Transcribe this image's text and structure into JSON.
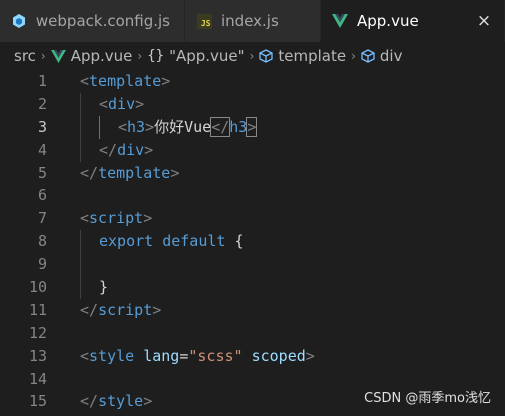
{
  "tabs": [
    {
      "label": "webpack.config.js",
      "icon": "webpack-icon",
      "active": false
    },
    {
      "label": "index.js",
      "icon": "js-file-icon",
      "badge": "JS",
      "active": false
    },
    {
      "label": "App.vue",
      "icon": "vue-icon",
      "active": true,
      "close": "×"
    }
  ],
  "breadcrumb": {
    "items": [
      "src",
      "App.vue",
      "\"App.vue\"",
      "template",
      "div"
    ],
    "braces": "{}",
    "separator": "›"
  },
  "editor": {
    "current_line": 3,
    "lines": [
      {
        "n": "1",
        "tokens": [
          [
            "p",
            "<"
          ],
          [
            "tg",
            "template"
          ],
          [
            "p",
            ">"
          ]
        ]
      },
      {
        "n": "2",
        "tokens": [
          [
            "p",
            "<"
          ],
          [
            "tg",
            "div"
          ],
          [
            "p",
            ">"
          ]
        ]
      },
      {
        "n": "3",
        "tokens": [
          [
            "p",
            "<"
          ],
          [
            "tg",
            "h3"
          ],
          [
            "p",
            ">"
          ],
          [
            "tx",
            "你好Vue"
          ],
          [
            "p",
            "</"
          ],
          [
            "tg",
            "h3"
          ],
          [
            "p",
            ">"
          ]
        ]
      },
      {
        "n": "4",
        "tokens": [
          [
            "p",
            "</"
          ],
          [
            "tg",
            "div"
          ],
          [
            "p",
            ">"
          ]
        ]
      },
      {
        "n": "5",
        "tokens": [
          [
            "p",
            "</"
          ],
          [
            "tg",
            "template"
          ],
          [
            "p",
            ">"
          ]
        ]
      },
      {
        "n": "6",
        "tokens": []
      },
      {
        "n": "7",
        "tokens": [
          [
            "p",
            "<"
          ],
          [
            "tg",
            "script"
          ],
          [
            "p",
            ">"
          ]
        ]
      },
      {
        "n": "8",
        "tokens": [
          [
            "tg",
            "export"
          ],
          [
            "tx",
            " "
          ],
          [
            "tg",
            "default"
          ],
          [
            "tx",
            " {"
          ]
        ]
      },
      {
        "n": "9",
        "tokens": []
      },
      {
        "n": "10",
        "tokens": [
          [
            "tx",
            "}"
          ]
        ]
      },
      {
        "n": "11",
        "tokens": [
          [
            "p",
            "</"
          ],
          [
            "tg",
            "script"
          ],
          [
            "p",
            ">"
          ]
        ]
      },
      {
        "n": "12",
        "tokens": []
      },
      {
        "n": "13",
        "tokens": [
          [
            "p",
            "<"
          ],
          [
            "tg",
            "style"
          ],
          [
            "tx",
            " "
          ],
          [
            "at",
            "lang"
          ],
          [
            "tx",
            "="
          ],
          [
            "st",
            "\"scss\""
          ],
          [
            "tx",
            " "
          ],
          [
            "at",
            "scoped"
          ],
          [
            "p",
            ">"
          ]
        ]
      },
      {
        "n": "14",
        "tokens": []
      },
      {
        "n": "15",
        "tokens": [
          [
            "p",
            "</"
          ],
          [
            "tg",
            "style"
          ],
          [
            "p",
            ">"
          ]
        ]
      }
    ]
  },
  "watermark": "CSDN @雨季mo浅忆",
  "colors": {
    "vue_green": "#41b883",
    "webpack_blue": "#8ed6fb",
    "js_yellow": "#e8d44d",
    "template_icon": "#75beff"
  }
}
